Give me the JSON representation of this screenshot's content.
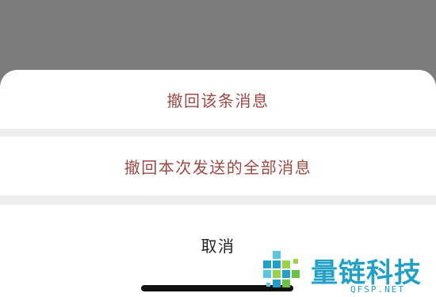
{
  "sheet": {
    "actions": [
      {
        "label": "撤回该条消息"
      },
      {
        "label": "撤回本次发送的全部消息"
      }
    ],
    "cancel_label": "取消",
    "accent_color": "#9b4a45"
  },
  "watermark": {
    "name": "量链科技",
    "url": "QFSP.NET",
    "color": "#22a1c4"
  }
}
